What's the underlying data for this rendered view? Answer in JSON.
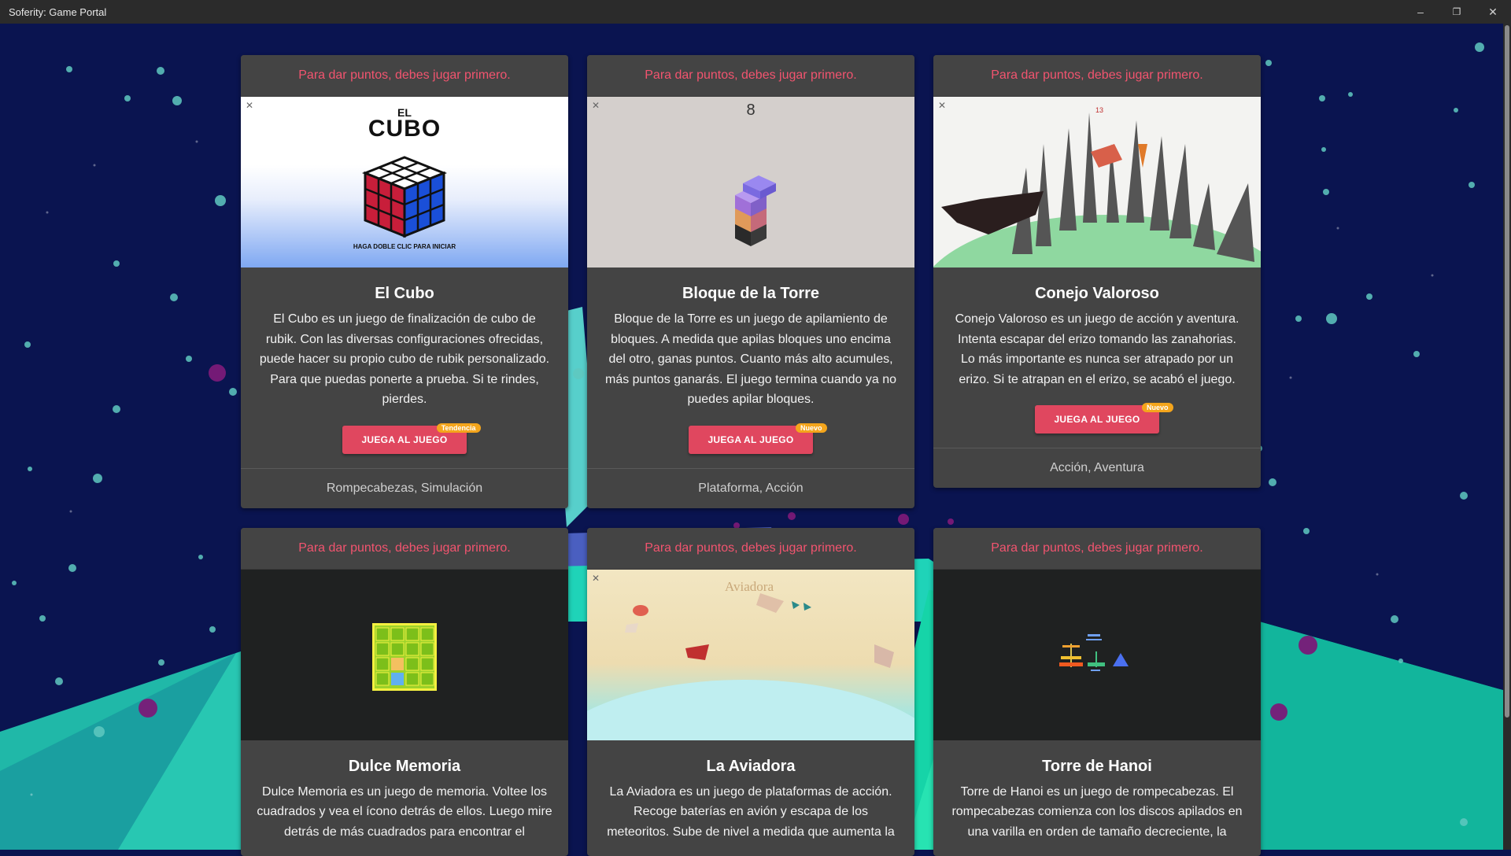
{
  "window": {
    "title": "Soferity: Game Portal",
    "controls": [
      "minimize",
      "restore",
      "close"
    ]
  },
  "games": [
    {
      "notice": "Para dar puntos, debes jugar primero.",
      "name": "El Cubo",
      "description": "El Cubo es un juego de finalización de cubo de rubik. Con las diversas configuraciones ofrecidas, puede hacer su propio cubo de rubik personalizado. Para que puedas ponerte a prueba. Si te rindes, pierdes.",
      "play_label": "JUEGA AL JUEGO",
      "badge": "Tendencia",
      "categories": "Rompecabezas, Simulación",
      "thumb": {
        "logo_small": "EL",
        "logo_big": "CUBO",
        "caption": "HAGA DOBLE CLIC PARA INICIAR"
      }
    },
    {
      "notice": "Para dar puntos, debes jugar primero.",
      "name": "Bloque de la Torre",
      "description": "Bloque de la Torre es un juego de apilamiento de bloques. A medida que apilas bloques uno encima del otro, ganas puntos. Cuanto más alto acumules, más puntos ganarás. El juego termina cuando ya no puedes apilar bloques.",
      "play_label": "JUEGA AL JUEGO",
      "badge": "Nuevo",
      "categories": "Plataforma, Acción",
      "thumb": {
        "score": "8"
      }
    },
    {
      "notice": "Para dar puntos, debes jugar primero.",
      "name": "Conejo Valoroso",
      "description": "Conejo Valoroso es un juego de acción y aventura. Intenta escapar del erizo tomando las zanahorias. Lo más importante es nunca ser atrapado por un erizo. Si te atrapan en el erizo, se acabó el juego.",
      "play_label": "JUEGA AL JUEGO",
      "badge": "Nuevo",
      "categories": "Acción, Aventura",
      "thumb": {
        "score": "13"
      }
    },
    {
      "notice": "Para dar puntos, debes jugar primero.",
      "name": "Dulce Memoria",
      "description": "Dulce Memoria es un juego de memoria. Voltee los cuadrados y vea el ícono detrás de ellos. Luego mire detrás de más cuadrados para encontrar el",
      "play_label": "",
      "badge": "",
      "categories": "",
      "thumb": {}
    },
    {
      "notice": "Para dar puntos, debes jugar primero.",
      "name": "La Aviadora",
      "description": "La Aviadora es un juego de plataformas de acción. Recoge baterías en avión y escapa de los meteoritos. Sube de nivel a medida que aumenta la",
      "play_label": "",
      "badge": "",
      "categories": "",
      "thumb": {
        "logo": "Aviadora"
      }
    },
    {
      "notice": "Para dar puntos, debes jugar primero.",
      "name": "Torre de Hanoi",
      "description": "Torre de Hanoi es un juego de rompecabezas. El rompecabezas comienza con los discos apilados en una varilla en orden de tamaño decreciente, la",
      "play_label": "",
      "badge": "",
      "categories": "",
      "thumb": {}
    }
  ],
  "colors": {
    "notice": "#f2546f",
    "play_button": "#e0475f",
    "badge": "#f4a51c",
    "card": "#444444",
    "background": "#0a1450"
  }
}
